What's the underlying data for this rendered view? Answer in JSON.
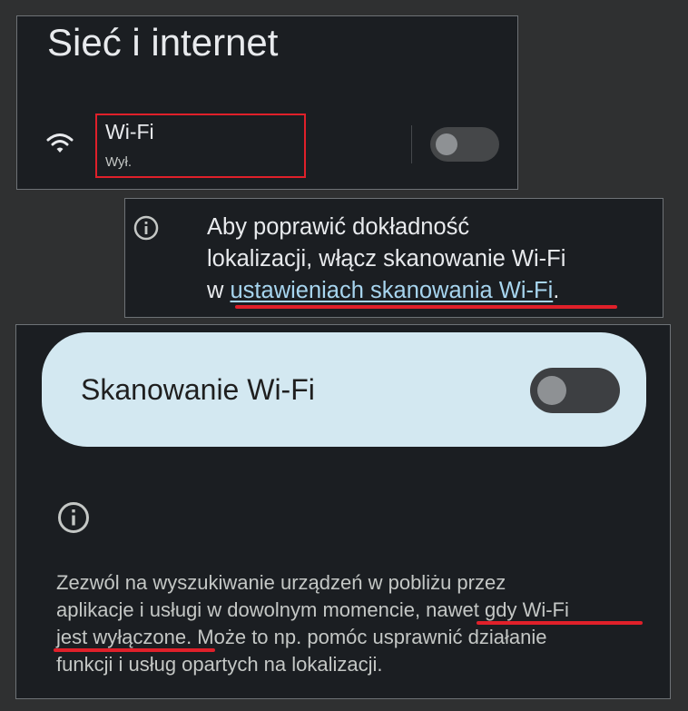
{
  "top": {
    "title": "Sieć i internet",
    "wifi": {
      "icon": "wifi-icon",
      "label": "Wi-Fi",
      "status": "Wył.",
      "enabled": false
    }
  },
  "notice": {
    "icon": "info-icon",
    "lines": [
      "Aby poprawić dokładność",
      "lokalizacji, włącz skanowanie Wi-Fi"
    ],
    "prefix": "w ",
    "link": "ustawieniach skanowania Wi-Fi",
    "suffix": "."
  },
  "scanning": {
    "label": "Skanowanie Wi-Fi",
    "enabled": false,
    "info_icon": "info-icon",
    "description_lines": [
      "Zezwól na wyszukiwanie urządzeń w pobliżu przez",
      "aplikacje i usługi w dowolnym momencie, nawet gdy Wi-Fi",
      "jest wyłączone. Może to np. pomóc usprawnić działanie",
      "funkcji i usług opartych na lokalizacji."
    ]
  },
  "colors": {
    "background": "#2f3031",
    "panel": "#1b1e22",
    "highlight": "#e0202a",
    "link": "#a7d5ef",
    "card": "#d3e8f1"
  }
}
